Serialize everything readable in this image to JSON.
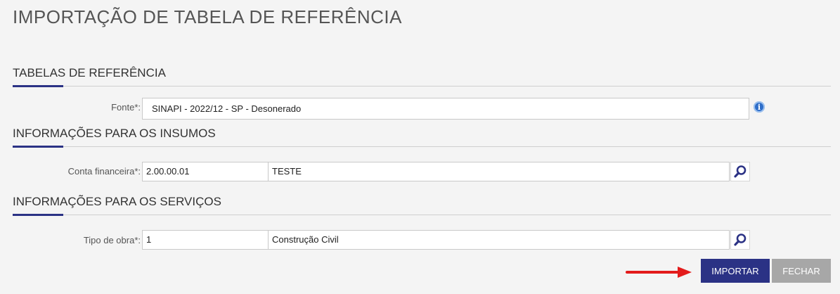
{
  "page": {
    "title": "IMPORTAÇÃO DE TABELA DE REFERÊNCIA"
  },
  "sections": {
    "referencia": {
      "title": "TABELAS DE REFERÊNCIA",
      "fonte": {
        "label": "Fonte*:",
        "value": "SINAPI - 2022/12 - SP - Desonerado"
      }
    },
    "insumos": {
      "title": "INFORMAÇÕES PARA OS INSUMOS",
      "conta": {
        "label": "Conta financeira*:",
        "code": "2.00.00.01",
        "description": "TESTE"
      }
    },
    "servicos": {
      "title": "INFORMAÇÕES PARA OS SERVIÇOS",
      "tipo_obra": {
        "label": "Tipo de obra*:",
        "code": "1",
        "description": "Construção Civil"
      }
    }
  },
  "actions": {
    "import_label": "IMPORTAR",
    "close_label": "FECHAR"
  },
  "colors": {
    "accent": "#2b3285",
    "arrow": "#e31b1b",
    "info": "#2f6ec9"
  },
  "icons": {
    "info": "info-icon",
    "lookup": "search-icon"
  }
}
